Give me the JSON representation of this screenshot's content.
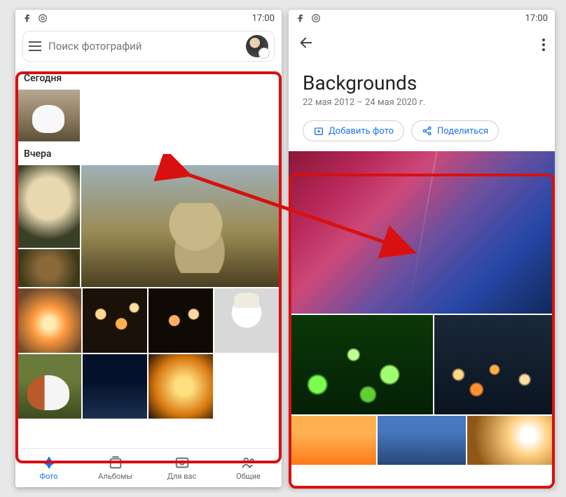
{
  "statusbar": {
    "time": "17:00"
  },
  "left": {
    "search": {
      "placeholder": "Поиск фотографий"
    },
    "sections": {
      "today": "Сегодня",
      "yesterday": "Вчера"
    },
    "nav": {
      "photos": "Фото",
      "albums": "Альбомы",
      "foryou": "Для вас",
      "shared": "Общие"
    }
  },
  "right": {
    "album": {
      "title": "Backgrounds",
      "date": "22 мая 2012 – 24 мая 2020 г."
    },
    "actions": {
      "add": "Добавить фото",
      "share": "Поделиться"
    }
  }
}
